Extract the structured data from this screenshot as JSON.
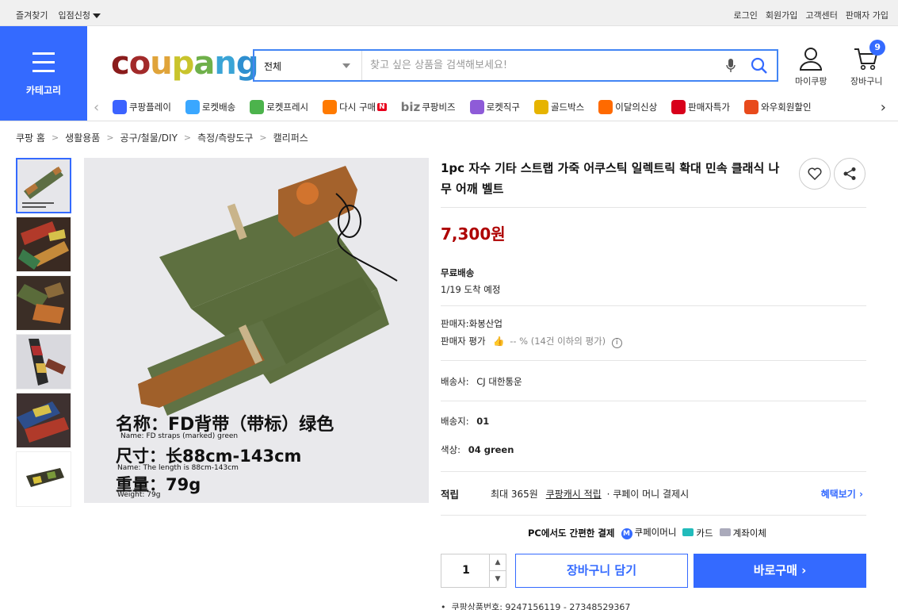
{
  "topbar": {
    "left": [
      "즐겨찾기",
      "입점신청"
    ],
    "right": [
      "로그인",
      "회원가입",
      "고객센터",
      "판매자 가입"
    ]
  },
  "header": {
    "category_label": "카테고리",
    "logo": "coupang",
    "search_scope": "전체",
    "search_placeholder": "찾고 싶은 상품을 검색해보세요!",
    "mycoupang": "마이쿠팡",
    "cart": "장바구니",
    "cart_count": "9"
  },
  "services": [
    {
      "label": "쿠팡플레이",
      "icon": "play-icon",
      "color": "#3c63ff"
    },
    {
      "label": "로켓배송",
      "icon": "rocket-icon",
      "color": "#3aa7ff"
    },
    {
      "label": "로켓프레시",
      "icon": "rocket-fresh-icon",
      "color": "#4cb34c"
    },
    {
      "label": "다시 구매",
      "icon": "rebuy-icon",
      "color": "#ff7a00",
      "badge": "N"
    },
    {
      "label": "쿠팡비즈",
      "icon": "biz-icon",
      "color": "#888888",
      "prefix": "biz"
    },
    {
      "label": "로켓직구",
      "icon": "global-icon",
      "color": "#8e5bd8"
    },
    {
      "label": "골드박스",
      "icon": "goldbox-icon",
      "color": "#e6b400"
    },
    {
      "label": "이달의신상",
      "icon": "new-icon",
      "color": "#ff6a00"
    },
    {
      "label": "판매자특가",
      "icon": "seller-sale-icon",
      "color": "#d8001b"
    },
    {
      "label": "와우회원할인",
      "icon": "wow-icon",
      "color": "#e84a1c"
    }
  ],
  "breadcrumb": [
    "쿠팡 홈",
    "생활용품",
    "공구/철물/DIY",
    "측정/측량도구",
    "캘리퍼스"
  ],
  "image_caption": {
    "line1": "名称：FD背带（带标）绿色",
    "line1_sub": "Name: FD straps (marked) green",
    "line2": "尺寸：长88cm-143cm",
    "line2_sub": "Name: The length is 88cm-143cm",
    "line3": "重量：79g",
    "line3_sub": "Weight: 79g"
  },
  "product": {
    "title": "1pc 자수 기타 스트랩 가죽 어쿠스틱 일렉트릭 확대 민속 클래식 나무 어깨 벨트",
    "price": "7,300원",
    "shipping_title": "무료배송",
    "arrival": "1/19 도착 예정",
    "seller": "판매자:화봉산업",
    "seller_rating_label": "판매자 평가",
    "seller_rating_value": "-- % (14건 이하의 평가)",
    "carrier_label": "배송사:",
    "carrier": "CJ 대한통운",
    "ship_from_label": "배송지:",
    "ship_from": "01",
    "color_label": "색상:",
    "color": "04 green",
    "reward_label": "적립",
    "reward_max": "최대 365원",
    "reward_cash": "쿠팡캐시 적립",
    "reward_method": "· 쿠페이 머니 결제시",
    "benefit_link": "혜택보기",
    "pay_title": "PC에서도 간편한 결제",
    "pay_coupay": "쿠페이머니",
    "pay_card": "카드",
    "pay_bank": "계좌이체",
    "qty": "1",
    "add_cart": "장바구니 담기",
    "buy_now": "바로구매",
    "product_no": "쿠팡상품번호: 9247156119 - 27348529367"
  }
}
